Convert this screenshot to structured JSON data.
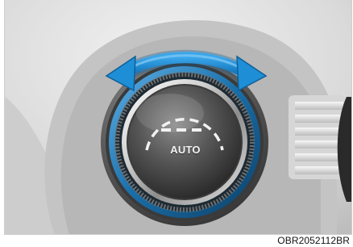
{
  "knob": {
    "label": "AUTO",
    "rotation_arrow_color": "#1e8fd6",
    "ring_accent_color": "#1a6ea8"
  },
  "caption": {
    "code": "OBR2052112BR"
  },
  "icons": [
    "rotate-arrows-icon",
    "temperature-arc-icon",
    "vent-grille"
  ]
}
